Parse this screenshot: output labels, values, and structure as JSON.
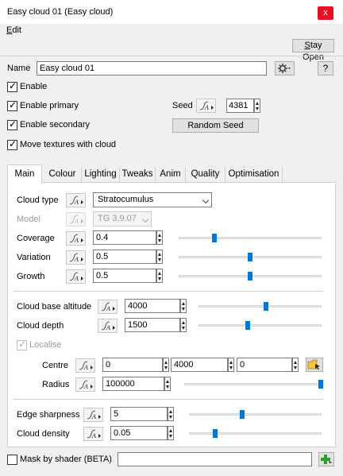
{
  "window": {
    "title": "Easy cloud 01    (Easy cloud)",
    "close_label": "x"
  },
  "menu": {
    "edit_prefix": "E",
    "edit_rest": "dit"
  },
  "toolbar": {
    "stay_open_prefix": "S",
    "stay_open_rest": "tay Open"
  },
  "name_field": {
    "label": "Name",
    "value": "Easy cloud 01",
    "gear_icon": "gear-icon",
    "help_label": "?"
  },
  "general": {
    "enable": {
      "label": "Enable",
      "checked": true
    },
    "enable_primary": {
      "label": "Enable primary",
      "checked": true
    },
    "enable_secondary": {
      "label": "Enable secondary",
      "checked": true
    },
    "move_textures": {
      "label": "Move textures with cloud",
      "checked": true
    },
    "seed_label": "Seed",
    "seed_value": "4381",
    "random_seed_label": "Random Seed"
  },
  "tabs": [
    {
      "label": "Main",
      "active": true
    },
    {
      "label": "Colour",
      "active": false
    },
    {
      "label": "Lighting",
      "active": false
    },
    {
      "label": "Tweaks",
      "active": false
    },
    {
      "label": "Anim",
      "active": false
    },
    {
      "label": "Quality",
      "active": false
    },
    {
      "label": "Optimisation",
      "active": false
    }
  ],
  "main": {
    "cloud_type": {
      "label": "Cloud type",
      "value": "Stratocumulus"
    },
    "model": {
      "label": "Model",
      "value": "TG 3.9.07"
    },
    "coverage": {
      "label": "Coverage",
      "value": "0.4",
      "slider": 0.25
    },
    "variation": {
      "label": "Variation",
      "value": "0.5",
      "slider": 0.5
    },
    "growth": {
      "label": "Growth",
      "value": "0.5",
      "slider": 0.5
    },
    "cloud_base_altitude": {
      "label": "Cloud base altitude",
      "value": "4000",
      "slider": 0.55
    },
    "cloud_depth": {
      "label": "Cloud depth",
      "value": "1500",
      "slider": 0.4
    },
    "localise": {
      "label": "Localise",
      "checked": true
    },
    "centre": {
      "label": "Centre",
      "x": "0",
      "y": "4000",
      "z": "0"
    },
    "radius": {
      "label": "Radius",
      "value": "100000",
      "slider": 1.0
    },
    "edge_sharpness": {
      "label": "Edge sharpness",
      "value": "5",
      "slider": 0.5
    },
    "cloud_density": {
      "label": "Cloud density",
      "value": "0.05",
      "slider": 0.2
    }
  },
  "footer": {
    "mask_label": "Mask by shader (BETA)",
    "mask_checked": false,
    "mask_value": "",
    "add_icon": "add-shader-icon"
  },
  "colors": {
    "accent": "#0078d7",
    "close": "#e81123"
  }
}
